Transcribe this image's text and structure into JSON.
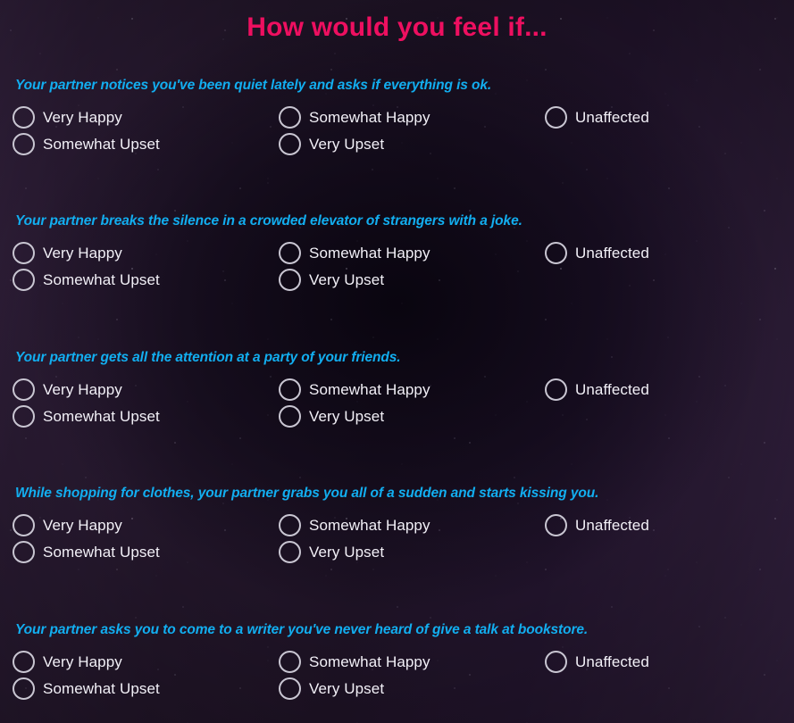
{
  "page": {
    "title": "How would you feel if...",
    "title_color": "#ee0f60",
    "question_color": "#12aef0",
    "label_color": "#f2f0f7",
    "background_color": "#241a2c"
  },
  "options": {
    "very_happy": "Very Happy",
    "somewhat_upset": "Somewhat Upset",
    "somewhat_happy": "Somewhat Happy",
    "very_upset": "Very Upset",
    "unaffected": "Unaffected"
  },
  "questions": [
    {
      "text": "Your partner notices you've been quiet lately and asks if everything is ok."
    },
    {
      "text": "Your partner breaks the silence in a crowded elevator of strangers with a joke."
    },
    {
      "text": "Your partner gets all the attention at a party of your friends."
    },
    {
      "text": "While shopping for clothes, your partner grabs you all of a sudden and starts kissing you."
    },
    {
      "text": "Your partner asks you to come to a writer you've never heard of give a talk at bookstore."
    }
  ]
}
